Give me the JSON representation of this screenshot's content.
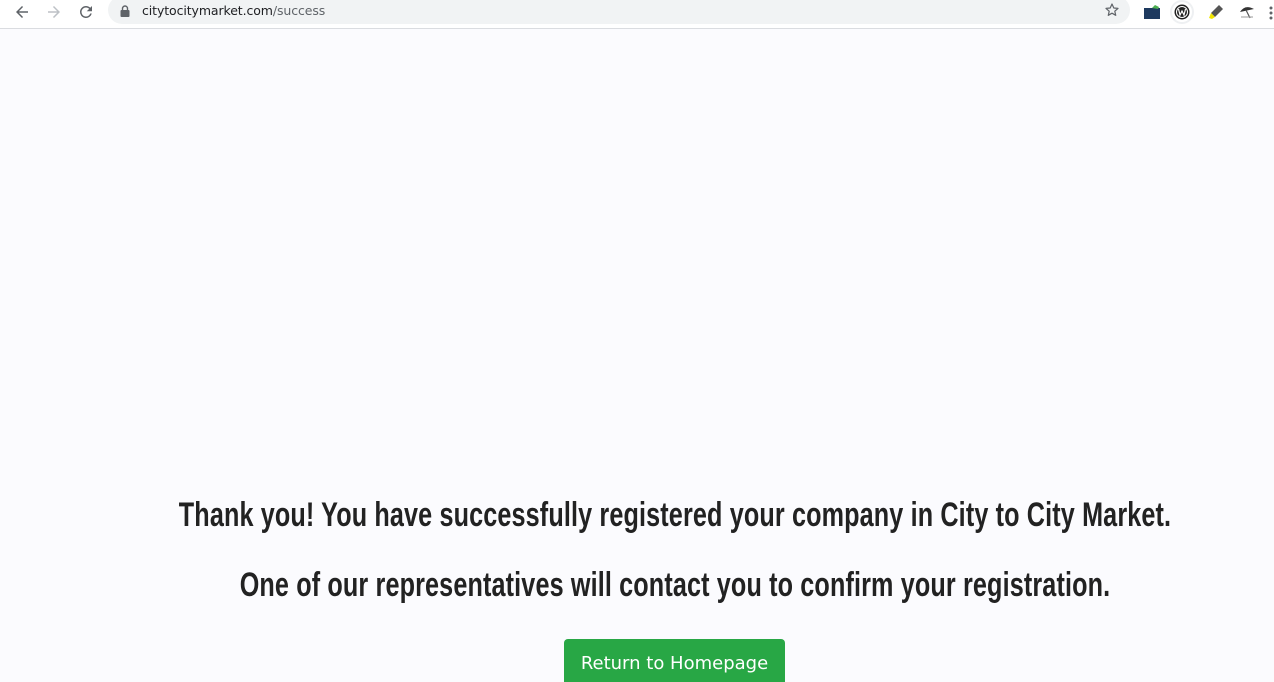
{
  "browser": {
    "url_domain": "citytocitymarket.com",
    "url_path": "/success",
    "icons": {
      "back": "arrow-left-icon",
      "forward": "arrow-right-icon",
      "reload": "reload-icon",
      "lock": "lock-icon",
      "bookmark": "star-icon",
      "extensions": [
        "folder-extension-icon",
        "w-extension-icon",
        "highlighter-extension-icon",
        "umbrella-extension-icon"
      ],
      "menu": "more-vertical-icon"
    }
  },
  "page": {
    "message_line1": "Thank you! You have successfully registered your company in City to City Market.",
    "message_line2": "One of our representatives will contact you to confirm your registration.",
    "return_button_label": "Return to Homepage",
    "colors": {
      "button": "#28a745",
      "text": "#222222",
      "background": "#fbfbfe"
    }
  }
}
